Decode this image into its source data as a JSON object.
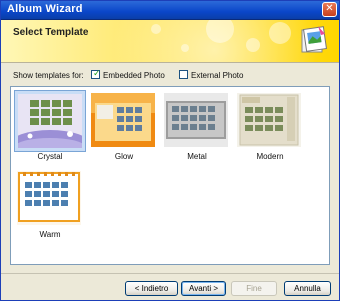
{
  "window": {
    "title": "Album Wizard",
    "close_label": "✕"
  },
  "banner": {
    "title": "Select Template",
    "icon": "album-photo-icon"
  },
  "filter": {
    "label": "Show templates for:",
    "options": [
      {
        "label": "Embedded Photo",
        "checked": true
      },
      {
        "label": "External Photo",
        "checked": false
      }
    ]
  },
  "templates": [
    {
      "name": "Crystal",
      "selected": true
    },
    {
      "name": "Glow",
      "selected": false
    },
    {
      "name": "Metal",
      "selected": false
    },
    {
      "name": "Modern",
      "selected": false
    },
    {
      "name": "Warm",
      "selected": false
    }
  ],
  "footer": {
    "back_label": "< Indietro",
    "next_label": "Avanti >",
    "finish_label": "Fine",
    "cancel_label": "Annulla"
  },
  "colors": {
    "titlebar": "#0a46c9",
    "banner": "#ffd600",
    "selection": "#c9ddf6"
  }
}
